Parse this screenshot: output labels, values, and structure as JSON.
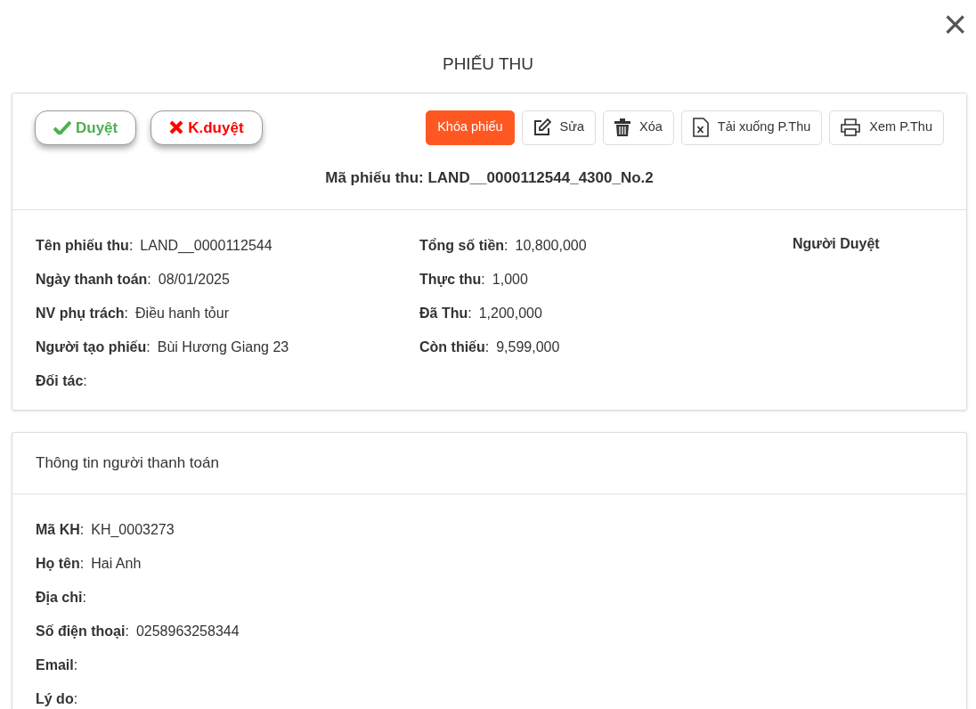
{
  "dialog": {
    "close": "×",
    "title": "PHIẾU THU"
  },
  "receipt": {
    "approval_buttons": [
      {
        "kind": "approve",
        "label": "Duyệt"
      },
      {
        "kind": "reject",
        "label": "K.duyệt"
      }
    ],
    "actions": [
      {
        "kind": "lock",
        "label": "Khóa phiếu"
      },
      {
        "kind": "edit",
        "label": "Sửa"
      },
      {
        "kind": "delete",
        "label": "Xóa"
      },
      {
        "kind": "excel",
        "label": "Tải xuống P.Thu"
      },
      {
        "kind": "print",
        "label": "Xem P.Thu"
      }
    ],
    "code": "Mã phiếu thu: LAND__0000112544_4300_No.2",
    "left_fields": [
      {
        "label": "**Tên phiếu thu**:",
        "value": "LAND__0000112544"
      },
      {
        "label": "**Ngày thanh toán**:",
        "value": "08/01/2025"
      },
      {
        "label": "**NV phụ trách**:",
        "value": "Điều hanh tỏur"
      },
      {
        "label": "**Người tạo phiếu**:",
        "value": "Bùi Hương Giang 23"
      },
      {
        "label": "**Đối tác**:"
      }
    ],
    "right_fields": [
      {
        "label": "**Tổng số tiền**:",
        "value": "10,800,000"
      },
      {
        "label": "**Thực thu**:",
        "value": "1,000"
      },
      {
        "label": "**Đã Thu**:",
        "value": "1,200,000"
      },
      {
        "label": "**Còn thiếu**:",
        "value": "9,599,000"
      }
    ],
    "approver_heading": "Người Duyệt"
  },
  "payer": {
    "title": "Thông tin người thanh toán",
    "fields": [
      {
        "label": "**Mã KH**:",
        "value": "KH_0003273"
      },
      {
        "label": "**Họ tên**:",
        "value": "Hai Anh"
      },
      {
        "label": "**Địa chỉ**:"
      },
      {
        "label": "**Số điện thoại**:",
        "value": "0258963258344"
      },
      {
        "label": "**Email**:"
      },
      {
        "label": "**Lý do**:"
      }
    ]
  }
}
